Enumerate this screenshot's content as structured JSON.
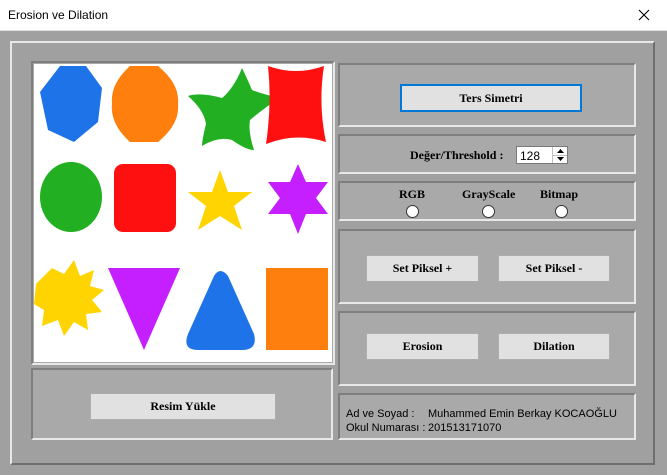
{
  "window": {
    "title": "Erosion ve Dilation",
    "close_icon": "close-icon"
  },
  "buttons": {
    "ters_simetri": "Ters Simetri",
    "resim_yukle": "Resim Yükle",
    "set_piksel_plus": "Set Piksel +",
    "set_piksel_minus": "Set Piksel -",
    "erosion": "Erosion",
    "dilation": "Dilation"
  },
  "threshold": {
    "label": "Değer/Threshold :",
    "value": "128"
  },
  "color_modes": [
    {
      "label": "RGB",
      "selected": false
    },
    {
      "label": "GrayScale",
      "selected": false
    },
    {
      "label": "Bitmap",
      "selected": false
    }
  ],
  "info": {
    "name_label": "Ad ve Soyad :",
    "name_value": "Muhammed Emin Berkay KOCAOĞLU",
    "number_label": "Okul Numarası :",
    "number_value": "201513171070"
  },
  "image_shapes": [
    {
      "name": "blue-heptagon",
      "color": "#1e73e8"
    },
    {
      "name": "orange-octagon",
      "color": "#ff7f0e"
    },
    {
      "name": "green-star",
      "color": "#22b022"
    },
    {
      "name": "red-rounded-square",
      "color": "#ff1010"
    },
    {
      "name": "green-ellipse",
      "color": "#22b022"
    },
    {
      "name": "red-rounded-rect",
      "color": "#ff1010"
    },
    {
      "name": "yellow-star",
      "color": "#ffd400"
    },
    {
      "name": "purple-six-point-star",
      "color": "#c51fff"
    },
    {
      "name": "yellow-burst",
      "color": "#ffd400"
    },
    {
      "name": "purple-triangle",
      "color": "#c51fff"
    },
    {
      "name": "blue-rounded-triangle",
      "color": "#1e73e8"
    },
    {
      "name": "orange-rectangle",
      "color": "#ff7f0e"
    }
  ]
}
